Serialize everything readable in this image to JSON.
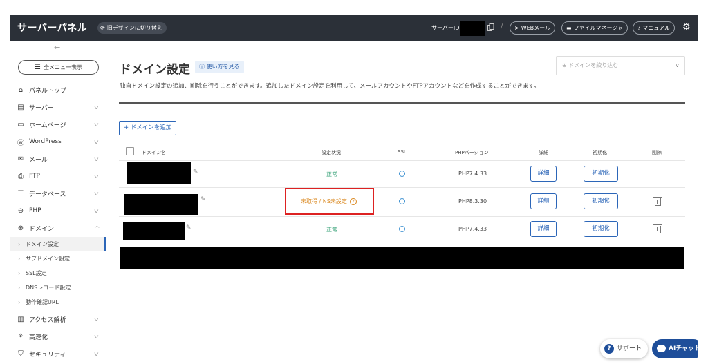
{
  "header": {
    "brand": "サーバーパネル",
    "old_design": "旧デザインに切り替え",
    "server_id_label": "サーバーID",
    "separator": "/",
    "webmail": "WEBメール",
    "file_manager": "ファイルマネージャ",
    "manual": "マニュアル"
  },
  "sidebar": {
    "back": "←",
    "all_menu": "全メニュー表示",
    "items": [
      {
        "label": "パネルトップ",
        "icon": "home-icon"
      },
      {
        "label": "サーバー",
        "icon": "server-icon"
      },
      {
        "label": "ホームページ",
        "icon": "browser-icon"
      },
      {
        "label": "WordPress",
        "icon": "wordpress-icon"
      },
      {
        "label": "メール",
        "icon": "mail-icon"
      },
      {
        "label": "FTP",
        "icon": "ftp-icon"
      },
      {
        "label": "データベース",
        "icon": "database-icon"
      },
      {
        "label": "PHP",
        "icon": "php-icon"
      },
      {
        "label": "ドメイン",
        "icon": "globe-icon"
      }
    ],
    "sub_items": [
      {
        "label": "ドメイン設定"
      },
      {
        "label": "サブドメイン設定"
      },
      {
        "label": "SSL設定"
      },
      {
        "label": "DNSレコード設定"
      },
      {
        "label": "動作確認URL"
      }
    ],
    "lower_items": [
      {
        "label": "アクセス解析",
        "icon": "analytics-icon"
      },
      {
        "label": "高速化",
        "icon": "speed-icon"
      },
      {
        "label": "セキュリティ",
        "icon": "shield-icon"
      }
    ]
  },
  "main": {
    "title": "ドメイン設定",
    "howto": "使い方を見る",
    "filter_placeholder": "ドメインを絞り込む",
    "description": "独自ドメイン設定の追加、削除を行うことができます。追加したドメイン設定を利用して、メールアカウントやFTPアカウントなどを作成することができます。",
    "add_domain": "+ ドメインを追加",
    "columns": {
      "domain": "ドメイン名",
      "status": "設定状況",
      "ssl": "SSL",
      "php": "PHPバージョン",
      "detail": "詳細",
      "init": "初期化",
      "delete": "削除"
    },
    "rows": [
      {
        "status": "正常",
        "php": "PHP7.4.33",
        "detail": "詳細",
        "init": "初期化"
      },
      {
        "status": "未取得 / NS未設定",
        "php": "PHP8.3.30",
        "detail": "詳細",
        "init": "初期化"
      },
      {
        "status": "正常",
        "php": "PHP7.4.33",
        "detail": "詳細",
        "init": "初期化"
      }
    ]
  },
  "floating": {
    "support": "サポート",
    "ai_chat": "AIチャット"
  }
}
